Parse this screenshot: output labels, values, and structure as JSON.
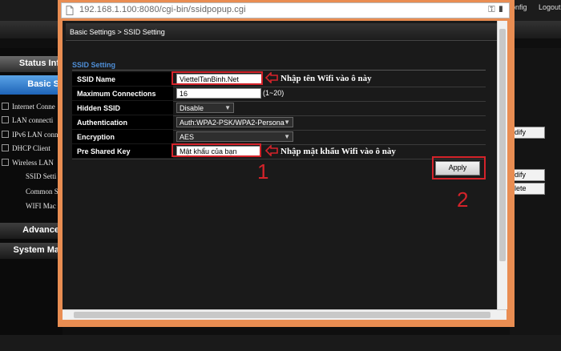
{
  "background": {
    "top_right": [
      "onfig",
      "Logout"
    ],
    "sidebar": {
      "status": "Status Inf",
      "basic": "Basic S",
      "items": [
        "Internet Conne",
        "LAN connecti",
        "IPv6 LAN conn",
        "DHCP Client",
        "Wireless LAN"
      ],
      "subitems": [
        "SSID Setti",
        "Common S",
        "WIFI Mac"
      ],
      "advanced": "Advance",
      "system": "System Ma"
    },
    "right_buttons": [
      "odify",
      "odify",
      "elete"
    ]
  },
  "popup": {
    "url": "192.168.1.100:8080/cgi-bin/ssidpopup.cgi",
    "breadcrumb": "Basic Settings > SSID Setting",
    "section_title": "SSID Setting",
    "fields": {
      "ssid_name": {
        "label": "SSID Name",
        "value": "ViettelTanBinh.Net"
      },
      "max_connections": {
        "label": "Maximum Connections",
        "value": "16",
        "hint": "(1~20)"
      },
      "hidden_ssid": {
        "label": "Hidden SSID",
        "value": "Disable"
      },
      "authentication": {
        "label": "Authentication",
        "value": "Auth:WPA2-PSK/WPA2-Persona"
      },
      "encryption": {
        "label": "Encryption",
        "value": "AES"
      },
      "pre_shared_key": {
        "label": "Pre Shared Key",
        "value": "Mật khẩu của bạn"
      }
    },
    "apply_label": "Apply",
    "annotations": {
      "ssid_note": "Nhập tên Wifi vào ô này",
      "key_note": "Nhập mật khẩu Wifi vào ô này",
      "step1": "1",
      "step2": "2"
    },
    "accent_color": "#d4232a"
  }
}
